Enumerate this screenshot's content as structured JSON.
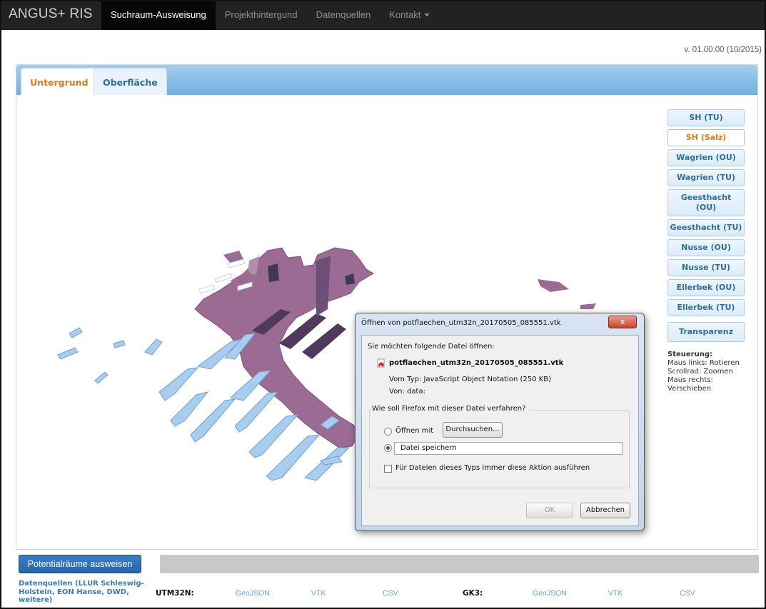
{
  "navbar": {
    "brand": "ANGUS+ RIS",
    "items": [
      {
        "label": "Suchraum-Ausweisung",
        "active": true
      },
      {
        "label": "Projekthintergund",
        "active": false
      },
      {
        "label": "Datenquellen",
        "active": false
      },
      {
        "label": "Kontakt",
        "active": false,
        "dropdown": true
      }
    ]
  },
  "version": "v. 01.00.00 (10/2015)",
  "tabs": [
    {
      "label": "Untergrund",
      "active": true
    },
    {
      "label": "Oberfläche",
      "active": false
    }
  ],
  "sidebar": {
    "buttons": [
      {
        "label": "SH (TU)",
        "active": false
      },
      {
        "label": "SH (Salz)",
        "active": true
      },
      {
        "label": "Wagrien (OU)",
        "active": false
      },
      {
        "label": "Wagrien (TU)",
        "active": false
      },
      {
        "label": "Geesthacht (OU)",
        "active": false
      },
      {
        "label": "Geesthacht (TU)",
        "active": false
      },
      {
        "label": "Nusse (OU)",
        "active": false
      },
      {
        "label": "Nusse (TU)",
        "active": false
      },
      {
        "label": "Ellerbek (OU)",
        "active": false
      },
      {
        "label": "Ellerbek (TU)",
        "active": false
      }
    ],
    "transparency_label": "Transparenz",
    "help": {
      "title": "Steuerung:",
      "lines": [
        "Maus links: Rotieren",
        "Scrollrad: Zoomen",
        "Maus rechts:",
        "Verschieben"
      ]
    }
  },
  "dialog": {
    "title": "Öffnen von potflaechen_utm32n_20170505_085551.vtk",
    "close_label": "x",
    "intro": "Sie möchten folgende Datei öffnen:",
    "file_name": "potflaechen_utm32n_20170505_085551.vtk",
    "type_line": "Vom Typ: JavaScript Object Notation (250 KB)",
    "from_line": "Von: data:",
    "question": "Wie soll Firefox mit dieser Datei verfahren?",
    "open_with_label": "Öffnen mit",
    "browse_label": "Durchsuchen...",
    "save_label": "Datei speichern",
    "always_label": "Für Dateien dieses Typs immer diese Aktion ausführen",
    "ok_label": "OK",
    "cancel_label": "Abbrechen",
    "selected_option": "save"
  },
  "bottom": {
    "primary_button": "Potentialräume ausweisen",
    "sources_link": "Datenquellen (LLUR Schleswig-Holstein, EON Hanse, DWD, weitere)",
    "utm_label": "UTM32N:",
    "gk_label": "GK3:",
    "utm_links": [
      "GeoJSON",
      "VTK",
      "CSV"
    ],
    "gk_links": [
      "GeoJSON",
      "VTK",
      "CSV"
    ]
  },
  "colors": {
    "navbar": "#222222",
    "accent_orange": "#e27a1b",
    "tab_bar": "#72afe0",
    "salt_dome": "#9b6b94",
    "aquifer": "#a8cdee",
    "primary_button": "#2a64a6"
  }
}
